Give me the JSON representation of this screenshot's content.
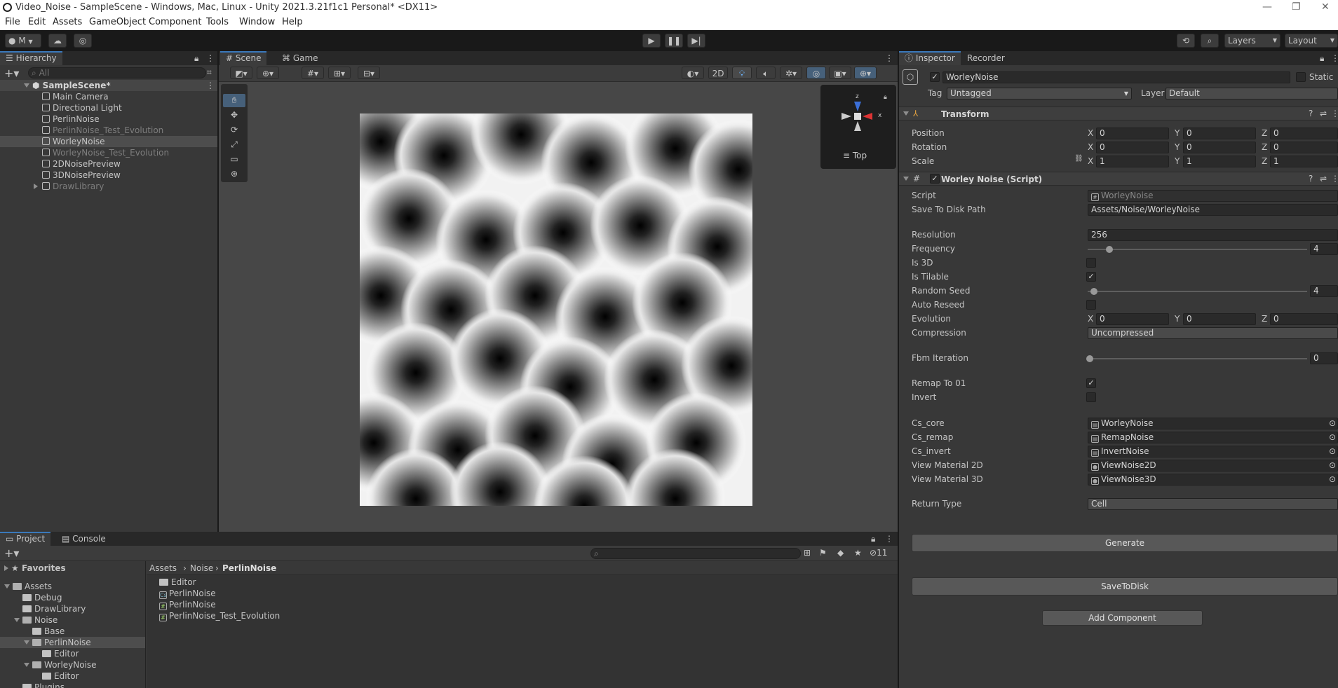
{
  "window": {
    "title": "Video_Noise - SampleScene - Windows, Mac, Linux - Unity 2021.3.21f1c1 Personal* <DX11>",
    "minimize": "—",
    "maximize": "❐",
    "close": "✕"
  },
  "menu": [
    "File",
    "Edit",
    "Assets",
    "GameObject",
    "Component",
    "Tools",
    "Window",
    "Help"
  ],
  "toolbar": {
    "account": "M",
    "layers": "Layers",
    "layout": "Layout"
  },
  "hierarchy": {
    "tab": "Hierarchy",
    "search_placeholder": "All",
    "scene": "SampleScene*",
    "items": [
      {
        "label": "Main Camera",
        "dim": false
      },
      {
        "label": "Directional Light",
        "dim": false
      },
      {
        "label": "PerlinNoise",
        "dim": false
      },
      {
        "label": "PerlinNoise_Test_Evolution",
        "dim": true
      },
      {
        "label": "WorleyNoise",
        "dim": false
      },
      {
        "label": "WorleyNoise_Test_Evolution",
        "dim": true
      },
      {
        "label": "2DNoisePreview",
        "dim": false
      },
      {
        "label": "3DNoisePreview",
        "dim": false
      },
      {
        "label": "DrawLibrary",
        "dim": true
      }
    ]
  },
  "scene_view": {
    "tabs": [
      "Scene",
      "Game"
    ],
    "mode_2d": "2D",
    "gizmo_label": "Top",
    "axis_x": "x",
    "axis_z": "z"
  },
  "inspector": {
    "tabs": [
      "Inspector",
      "Recorder"
    ],
    "object_name": "WorleyNoise",
    "static_label": "Static",
    "tag_label": "Tag",
    "tag_value": "Untagged",
    "layer_label": "Layer",
    "layer_value": "Default",
    "transform": {
      "title": "Transform",
      "rows": [
        {
          "label": "Position",
          "x": "0",
          "y": "0",
          "z": "0"
        },
        {
          "label": "Rotation",
          "x": "0",
          "y": "0",
          "z": "0"
        },
        {
          "label": "Scale",
          "x": "1",
          "y": "1",
          "z": "1"
        }
      ]
    },
    "script_component": {
      "title": "Worley Noise (Script)",
      "script_label": "Script",
      "script_value": "WorleyNoise",
      "save_path_label": "Save To Disk Path",
      "save_path_value": "Assets/Noise/WorleyNoise",
      "resolution_label": "Resolution",
      "resolution_value": "256",
      "frequency_label": "Frequency",
      "frequency_value": "4",
      "frequency_fraction": 0.1,
      "is3d_label": "Is 3D",
      "is3d_checked": false,
      "tilable_label": "Is Tilable",
      "tilable_checked": true,
      "seed_label": "Random Seed",
      "seed_value": "4",
      "seed_fraction": 0.03,
      "autoreseed_label": "Auto Reseed",
      "autoreseed_checked": false,
      "evolution_label": "Evolution",
      "evolution": {
        "x": "0",
        "y": "0",
        "z": "0"
      },
      "compression_label": "Compression",
      "compression_value": "Uncompressed",
      "fbm_label": "Fbm Iteration",
      "fbm_value": "0",
      "remap_label": "Remap To 01",
      "remap_checked": true,
      "invert_label": "Invert",
      "invert_checked": false,
      "refs": [
        {
          "label": "Cs_core",
          "value": "WorleyNoise"
        },
        {
          "label": "Cs_remap",
          "value": "RemapNoise"
        },
        {
          "label": "Cs_invert",
          "value": "InvertNoise"
        },
        {
          "label": "View Material 2D",
          "value": "ViewNoise2D"
        },
        {
          "label": "View Material 3D",
          "value": "ViewNoise3D"
        }
      ],
      "return_type_label": "Return Type",
      "return_type_value": "Cell",
      "generate_label": "Generate",
      "save_label": "SaveToDisk"
    },
    "add_component": "Add Component"
  },
  "project": {
    "tabs": [
      "Project",
      "Console"
    ],
    "hidden_count": "11",
    "breadcrumb": [
      "Assets",
      "Noise",
      "PerlinNoise"
    ],
    "favorites": "Favorites",
    "tree": [
      {
        "label": "Assets",
        "level": 0
      },
      {
        "label": "Debug",
        "level": 1
      },
      {
        "label": "DrawLibrary",
        "level": 1
      },
      {
        "label": "Noise",
        "level": 1
      },
      {
        "label": "Base",
        "level": 2
      },
      {
        "label": "PerlinNoise",
        "level": 2
      },
      {
        "label": "Editor",
        "level": 3
      },
      {
        "label": "WorleyNoise",
        "level": 2
      },
      {
        "label": "Editor",
        "level": 3
      },
      {
        "label": "Plugins",
        "level": 1
      }
    ],
    "files": [
      {
        "label": "Editor",
        "kind": "folder"
      },
      {
        "label": "PerlinNoise",
        "kind": "compute"
      },
      {
        "label": "PerlinNoise",
        "kind": "script"
      },
      {
        "label": "PerlinNoise_Test_Evolution",
        "kind": "script"
      }
    ]
  }
}
